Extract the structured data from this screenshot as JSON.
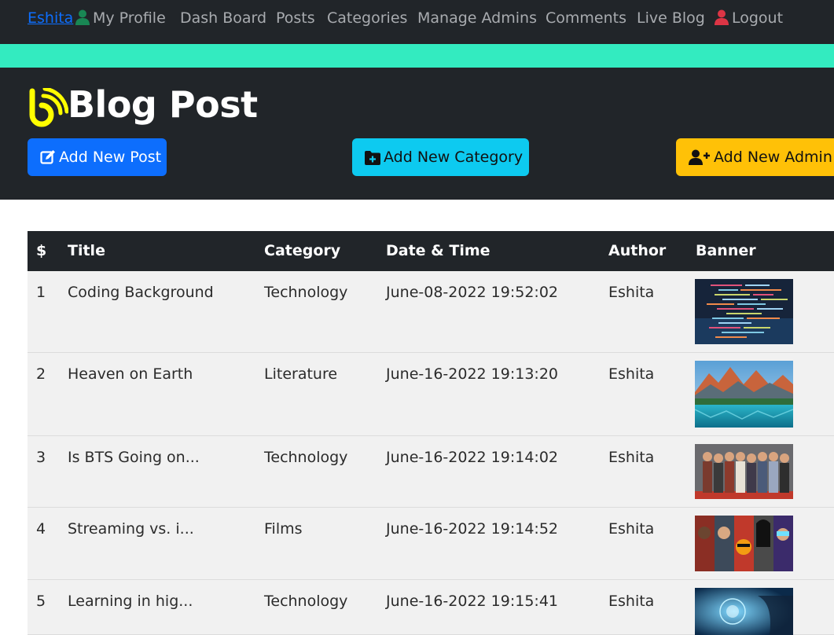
{
  "nav": {
    "user": "Eshita",
    "links": [
      "My Profile",
      "Dash Board",
      "Posts",
      "Categories",
      "Manage Admins",
      "Comments",
      "Live Blog"
    ],
    "logout": "Logout"
  },
  "colors": {
    "dark": "#212529",
    "accent_bar": "#33ebc0",
    "primary": "#0d6efd",
    "info": "#0dcaf0",
    "warning": "#ffc107",
    "profile_icon": "#198754",
    "logout_icon": "#dc3545",
    "title_icon": "#ffff00"
  },
  "header": {
    "title": "Blog Post",
    "title_icon": "blog-rss-icon",
    "buttons": {
      "add_post": "Add New Post",
      "add_category": "Add New Category",
      "add_admin": "Add New Admin"
    }
  },
  "table": {
    "columns": [
      "$",
      "Title",
      "Category",
      "Date & Time",
      "Author",
      "Banner"
    ],
    "rows": [
      {
        "num": "1",
        "title": "Coding Background",
        "category": "Technology",
        "datetime": "June-08-2022 19:52:02",
        "author": "Eshita",
        "banner": "code-screen-image"
      },
      {
        "num": "2",
        "title": "Heaven on Earth",
        "category": "Literature",
        "datetime": "June-16-2022 19:13:20",
        "author": "Eshita",
        "banner": "mountain-lake-image"
      },
      {
        "num": "3",
        "title": "Is BTS Going on...",
        "category": "Technology",
        "datetime": "June-16-2022 19:14:02",
        "author": "Eshita",
        "banner": "group-photo-image"
      },
      {
        "num": "4",
        "title": "Streaming vs. i...",
        "category": "Films",
        "datetime": "June-16-2022 19:14:52",
        "author": "Eshita",
        "banner": "movie-collage-image"
      },
      {
        "num": "5",
        "title": "Learning in hig...",
        "category": "Technology",
        "datetime": "June-16-2022 19:15:41",
        "author": "Eshita",
        "banner": "tech-hologram-image"
      }
    ]
  }
}
